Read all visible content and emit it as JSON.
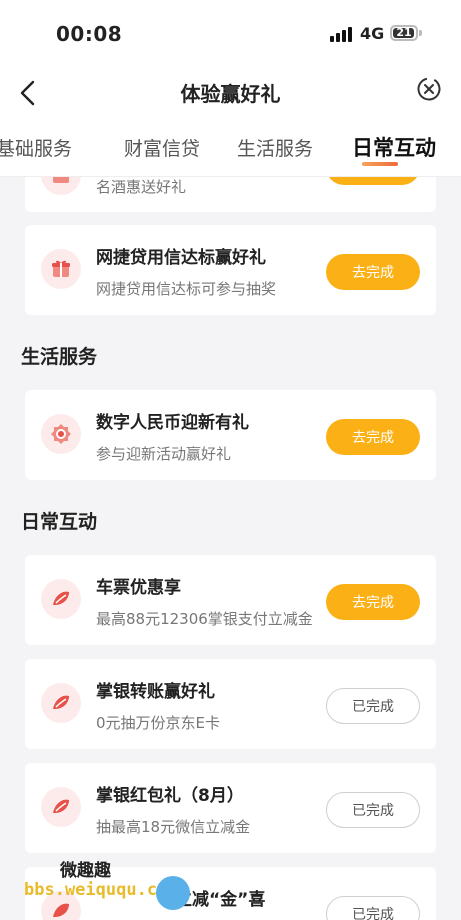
{
  "status_bar": {
    "time": "00:08",
    "network": "4G",
    "battery_level": "21"
  },
  "nav": {
    "title": "体验赢好礼"
  },
  "tabs": [
    {
      "label": "基础服务",
      "active": false
    },
    {
      "label": "财富信贷",
      "active": false
    },
    {
      "label": "生活服务",
      "active": false
    },
    {
      "label": "日常互动",
      "active": true
    }
  ],
  "top_partial_card": {
    "subtitle": "名酒惠送好礼"
  },
  "credit_card": {
    "title": "网捷贷用信达标赢好礼",
    "subtitle": "网捷贷用信达标可参与抽奖",
    "button": "去完成",
    "icon": "gift-icon"
  },
  "section_life": {
    "title": "生活服务",
    "items": [
      {
        "title": "数字人民币迎新有礼",
        "subtitle": "参与迎新活动赢好礼",
        "button": "去完成",
        "icon": "medal-icon"
      }
    ]
  },
  "section_daily": {
    "title": "日常互动",
    "items": [
      {
        "title": "车票优惠享",
        "subtitle": "最高88元12306掌银支付立减金",
        "button": "去完成",
        "state": "todo",
        "icon": "feather-icon"
      },
      {
        "title": "掌银转账赢好礼",
        "subtitle": "0元抽万份京东E卡",
        "button": "已完成",
        "state": "done",
        "icon": "feather-icon"
      },
      {
        "title": "掌银红包礼（8月）",
        "subtitle": "抽最高18元微信立减金",
        "button": "已完成",
        "state": "done",
        "icon": "feather-icon"
      },
      {
        "title": "立减“金”喜",
        "subtitle": "",
        "button": "已完成",
        "state": "done",
        "icon": "feather-icon"
      }
    ]
  },
  "watermark": {
    "line1": "微趣趣",
    "line2": "bbs.weiququ.cn"
  },
  "colors": {
    "accent": "#fbb116",
    "tab_underline": "#ee6b3c",
    "icon_bg": "#fdeaea",
    "icon_red": "#e8514a"
  }
}
